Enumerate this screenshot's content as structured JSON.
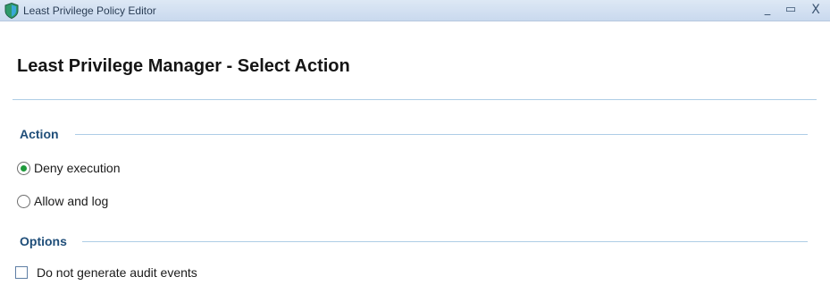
{
  "window": {
    "title": "Least Privilege Policy Editor",
    "controls": {
      "minimize": "_",
      "maximize": "▭",
      "close": "X"
    }
  },
  "header": {
    "title": "Least Privilege Manager - Select Action"
  },
  "action_section": {
    "title": "Action",
    "options": [
      {
        "label": "Deny execution",
        "checked": true
      },
      {
        "label": "Allow and log",
        "checked": false
      }
    ]
  },
  "options_section": {
    "title": "Options",
    "checkbox": {
      "label": "Do not generate audit events",
      "checked": false
    }
  },
  "colors": {
    "section_heading": "#1f4e79",
    "rule": "#aecde6",
    "radio_selected": "#1f9a3b",
    "titlebar": "#c9d9ee"
  },
  "icons": {
    "app": "shield-icon"
  }
}
